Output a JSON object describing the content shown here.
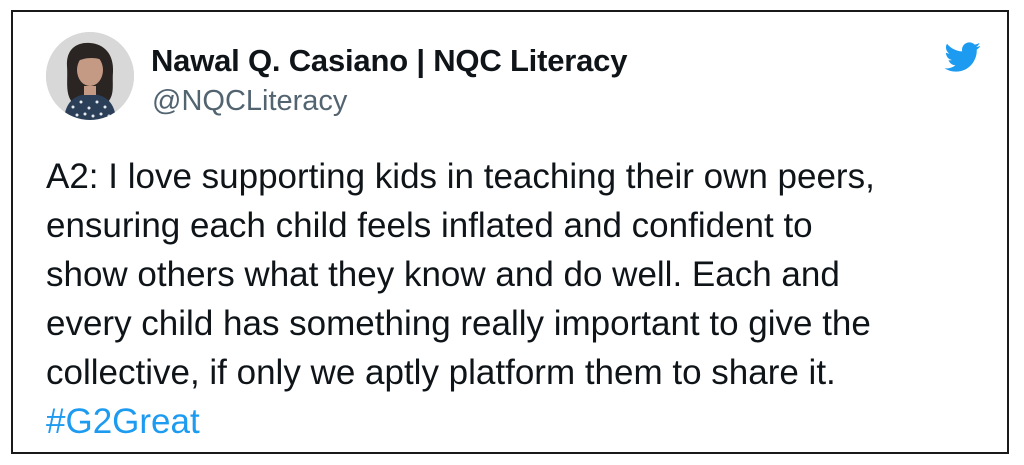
{
  "tweet": {
    "author_name": "Nawal Q. Casiano | NQC Literacy",
    "author_handle": "@NQCLiteracy",
    "avatar_icon": "profile-photo",
    "logo_icon": "twitter-bird-icon",
    "text_lines": [
      "A2: I love supporting kids in teaching their own peers,",
      "ensuring each child feels inflated and confident to",
      "show others what they know and do well. Each and",
      "every child has something really important to give the",
      "collective, if only we aptly platform them to share it."
    ],
    "hashtag": "#G2Great"
  },
  "colors": {
    "text": "#0f1419",
    "handle": "#536471",
    "link": "#1d9bf0",
    "border": "#1a1a1a",
    "background": "#ffffff"
  }
}
